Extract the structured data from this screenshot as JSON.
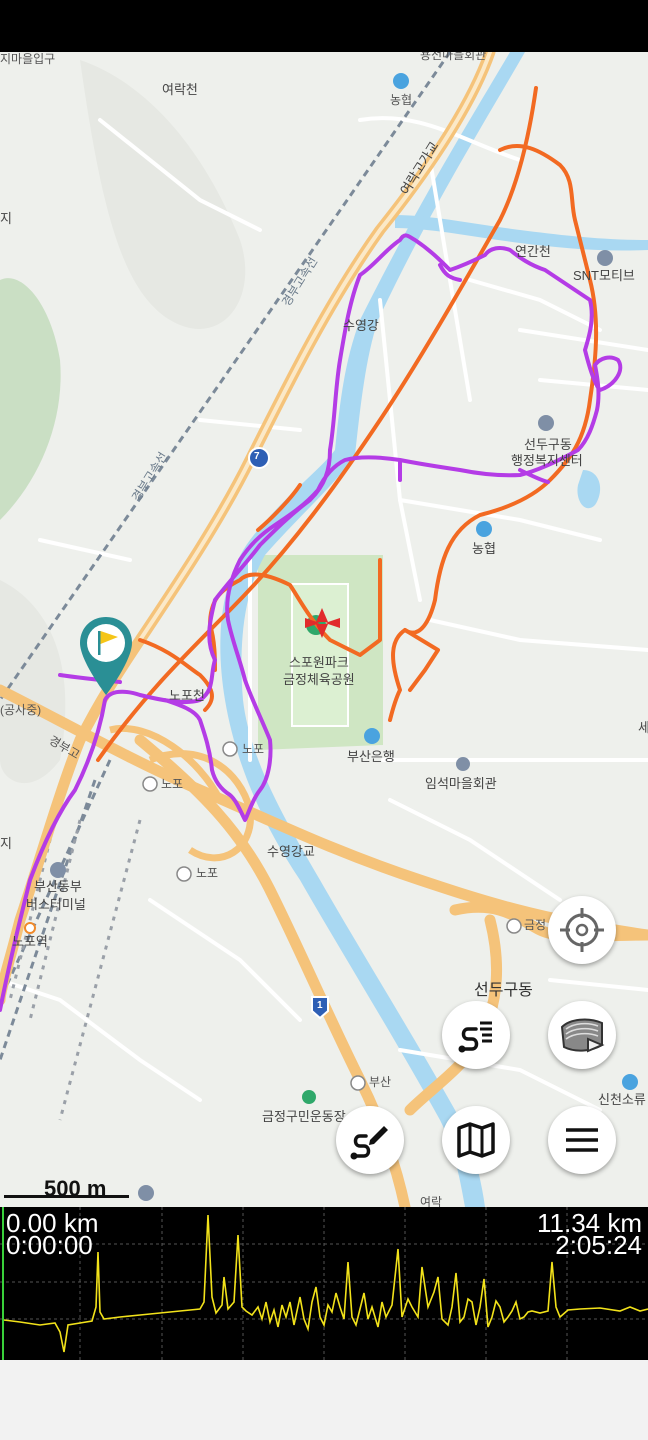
{
  "map": {
    "labels": {
      "yeorakcheon": "여락천",
      "nonghyup_top": "농협",
      "yeorakgogagyo": "여락고가교",
      "gyeongbu_expwy_1": "경부고속선",
      "gyeongbu_expwy_2": "경부고속선",
      "suyeonggang": "수영강",
      "yeongacheon": "연간천",
      "snt_motiv": "SNT모티브",
      "seondu_welfare_1": "선두구동",
      "seondu_welfare_2": "행정복지센터",
      "nonghyup_mid": "농협",
      "sports_park_1": "스포원파크",
      "sports_park_2": "금정체육공원",
      "nopocheon": "노포천",
      "busan_bank": "부산은행",
      "imseok_hall": "임석마을회관",
      "tg_nopo_1": "노포",
      "ic_nopo": "노포",
      "gyeongbu_1": "경부고",
      "suyeong_bridge": "수영강교",
      "tg_nopo_2": "노포",
      "busan_terminal_1": "부산동부",
      "busan_terminal_2": "버스터미널",
      "nopo_station": "노포역",
      "ic_geumjeong": "금정",
      "seondu_gu": "선두구동",
      "busan_ic": "부산",
      "geumjeong_stadium": "금정구민운동장",
      "sincheon": "신천소류",
      "gongsa": "(공사중)",
      "top_cut": "지마을입구",
      "top_cut2": "용전마을회관",
      "road_7": "7",
      "road_1": "1",
      "edge_ji1": "지",
      "edge_ji2": "지",
      "edge_se": "세",
      "yeorak_bottom": "여락"
    },
    "scale_label": "500 m",
    "icons": [
      "flag-marker-icon",
      "target-crosshair-icon",
      "layers-icon",
      "track-list-icon",
      "route-edit-icon",
      "map-icon",
      "menu-icon"
    ]
  },
  "elevation": {
    "start_distance": "0.00 km",
    "start_time": "0:00:00",
    "total_distance": "11.34 km",
    "total_time": "2:05:24"
  },
  "colors": {
    "track_purple": "#b43ce6",
    "track_orange": "#f26a22",
    "profile_yellow": "#f2e21a",
    "road_orange": "#f5c37a",
    "river": "#a9d8f2",
    "park": "#cfe6c3"
  }
}
